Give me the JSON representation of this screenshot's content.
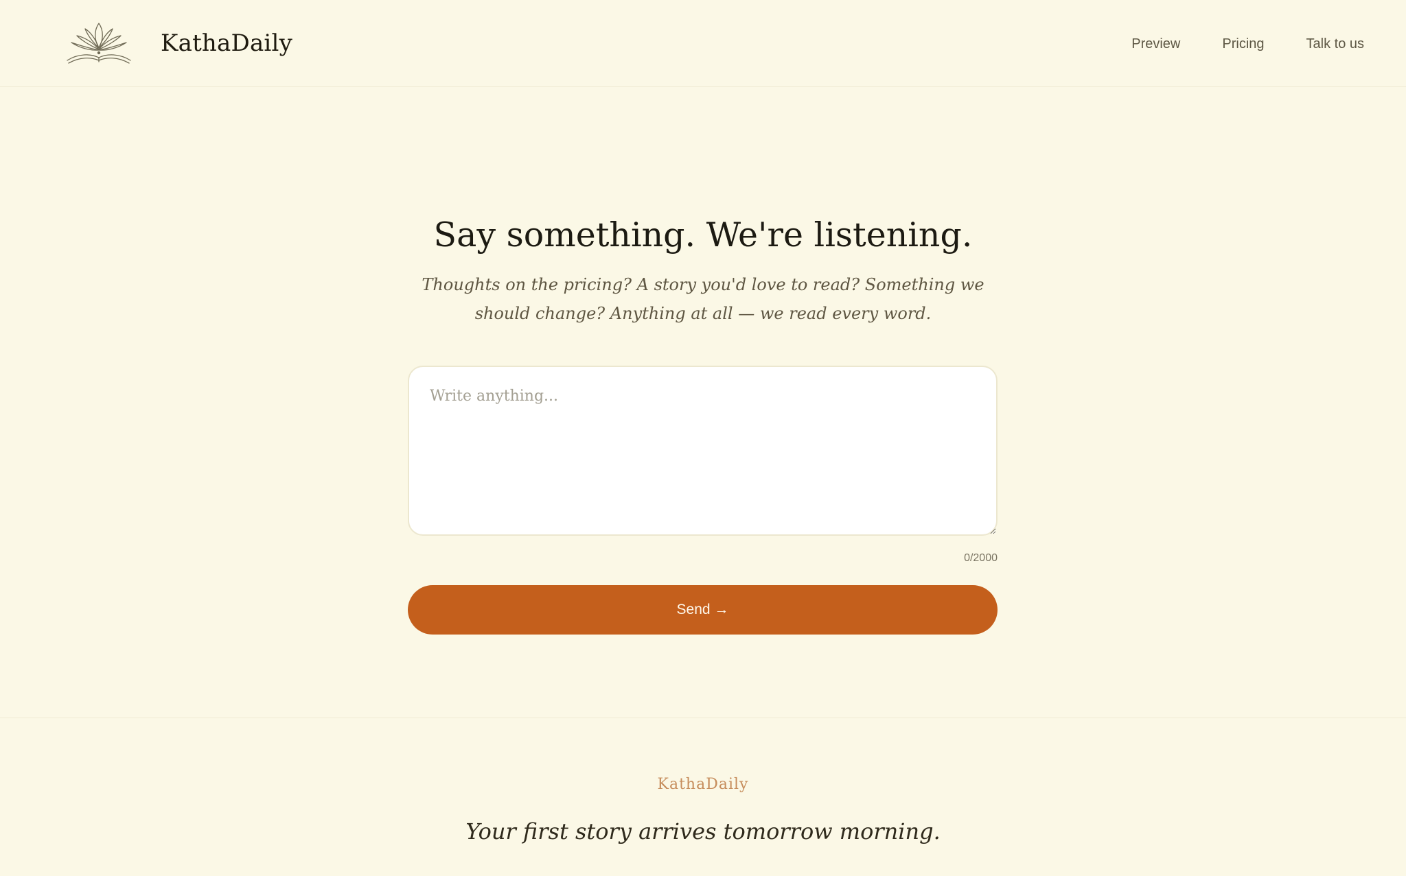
{
  "header": {
    "brand": "KathaDaily",
    "logo_icon": "lotus-book-icon",
    "nav": [
      {
        "label": "Preview"
      },
      {
        "label": "Pricing"
      },
      {
        "label": "Talk to us"
      }
    ]
  },
  "main": {
    "headline": "Say something. We're listening.",
    "subtitle": "Thoughts on the pricing? A story you'd love to read? Something we should change? Anything at all — we read every word.",
    "message": {
      "value": "",
      "placeholder": "Write anything..."
    },
    "counter": "0/2000",
    "send_label": "Send →"
  },
  "footer": {
    "brand": "KathaDaily",
    "tagline": "Your first story arrives tomorrow morning."
  },
  "colors": {
    "background": "#fbf8e6",
    "accent": "#c45f1c",
    "footer_brand": "#c68d5c"
  }
}
